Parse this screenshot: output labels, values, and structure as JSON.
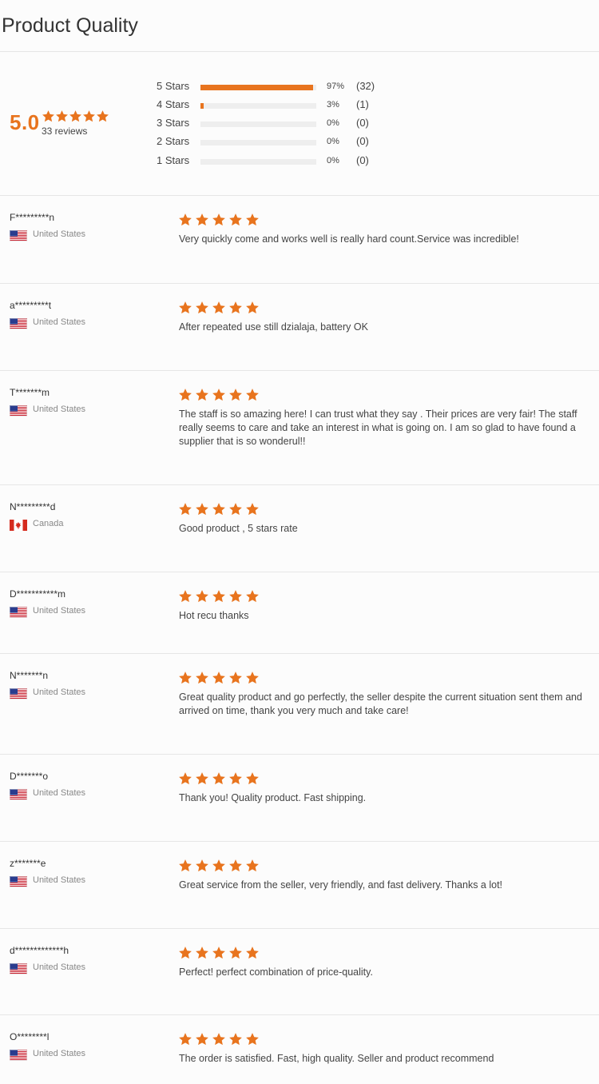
{
  "page": {
    "title": "Product Quality"
  },
  "colors": {
    "accent": "#e8741e",
    "track": "#eeeeee",
    "divider": "#e6e6e6"
  },
  "summary": {
    "score": "5.0",
    "rating": 5,
    "review_count": "33 reviews",
    "distribution": [
      {
        "label": "5 Stars",
        "percent_text": "97%",
        "count_text": "(32)",
        "fraction": 0.97
      },
      {
        "label": "4 Stars",
        "percent_text": "3%",
        "count_text": "(1)",
        "fraction": 0.03
      },
      {
        "label": "3 Stars",
        "percent_text": "0%",
        "count_text": "(0)",
        "fraction": 0
      },
      {
        "label": "2 Stars",
        "percent_text": "0%",
        "count_text": "(0)",
        "fraction": 0
      },
      {
        "label": "1 Stars",
        "percent_text": "0%",
        "count_text": "(0)",
        "fraction": 0
      }
    ]
  },
  "reviews": [
    {
      "name": "F*********n",
      "country": "United States",
      "flag_icon": "us-flag-icon",
      "rating": 5,
      "text": "Very quickly come and works well is really hard count.Service was incredible!"
    },
    {
      "name": "a*********t",
      "country": "United States",
      "flag_icon": "us-flag-icon",
      "rating": 5,
      "text": "After repeated use still dzialaja, battery OK"
    },
    {
      "name": "T*******m",
      "country": "United States",
      "flag_icon": "us-flag-icon",
      "rating": 5,
      "text": "The staff is so amazing here! I can trust what they say . Their prices are very fair! The staff really seems to care and take an interest in what is going on. I am so glad to have found a supplier that is so wonderul!!"
    },
    {
      "name": "N*********d",
      "country": "Canada",
      "flag_icon": "canada-flag-icon",
      "rating": 5,
      "text": "Good product , 5 stars rate"
    },
    {
      "name": "D***********m",
      "country": "United States",
      "flag_icon": "us-flag-icon",
      "rating": 5,
      "text": "Hot recu thanks"
    },
    {
      "name": "N*******n",
      "country": "United States",
      "flag_icon": "us-flag-icon",
      "rating": 5,
      "text": "Great quality product and go perfectly, the seller despite the current situation sent them and arrived on time, thank you very much and take care!"
    },
    {
      "name": "D*******o",
      "country": "United States",
      "flag_icon": "us-flag-icon",
      "rating": 5,
      "text": "Thank you! Quality product. Fast shipping."
    },
    {
      "name": "z*******e",
      "country": "United States",
      "flag_icon": "us-flag-icon",
      "rating": 5,
      "text": "Great service from the seller, very friendly, and fast delivery. Thanks a lot!"
    },
    {
      "name": "d*************h",
      "country": "United States",
      "flag_icon": "us-flag-icon",
      "rating": 5,
      "text": "Perfect! perfect combination of price-quality."
    },
    {
      "name": "O********l",
      "country": "United States",
      "flag_icon": "us-flag-icon",
      "rating": 5,
      "text": "The order is satisfied. Fast, high quality. Seller and product recommend"
    }
  ]
}
